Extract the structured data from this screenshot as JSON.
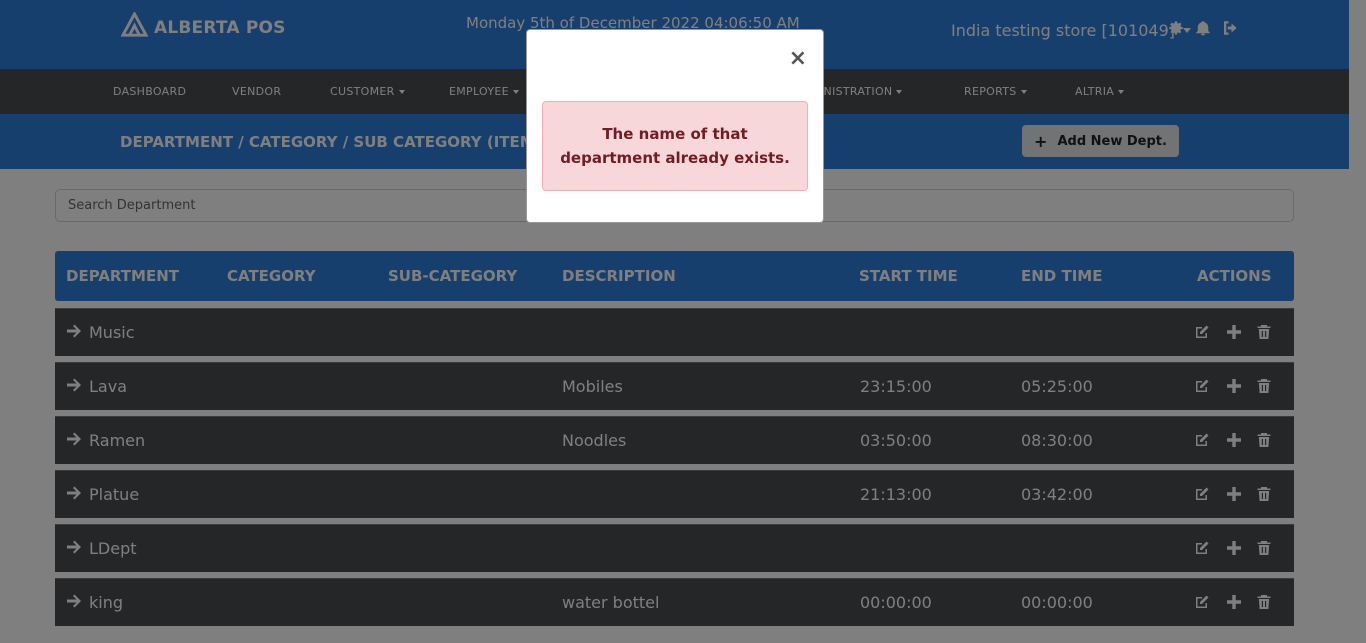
{
  "app": {
    "brand": "ALBERTA POS",
    "datetime": "Monday 5th of December 2022 04:06:50 AM",
    "store": "India testing store [101049]"
  },
  "nav": {
    "items": [
      {
        "label": "DASHBOARD"
      },
      {
        "label": "VENDOR"
      },
      {
        "label": "CUSTOMER"
      },
      {
        "label": "EMPLOYEE"
      },
      {
        "label": "INISTRATION"
      },
      {
        "label": "REPORTS"
      },
      {
        "label": "ALTRIA"
      }
    ]
  },
  "page": {
    "title": "DEPARTMENT / CATEGORY / SUB CATEGORY (ITEM CLASS",
    "add_label": "Add New Dept."
  },
  "search": {
    "placeholder": "Search Department"
  },
  "table": {
    "headers": [
      "DEPARTMENT",
      "CATEGORY",
      "SUB-CATEGORY",
      "DESCRIPTION",
      "START TIME",
      "END TIME",
      "ACTIONS"
    ],
    "rows": [
      {
        "department": "Music",
        "description": "",
        "start": "",
        "end": ""
      },
      {
        "department": "Lava",
        "description": "Mobiles",
        "start": "23:15:00",
        "end": "05:25:00"
      },
      {
        "department": "Ramen",
        "description": "Noodles",
        "start": "03:50:00",
        "end": "08:30:00"
      },
      {
        "department": "Platue",
        "description": "",
        "start": "21:13:00",
        "end": "03:42:00"
      },
      {
        "department": "LDept",
        "description": "",
        "start": "",
        "end": ""
      },
      {
        "department": "king",
        "description": "water bottel",
        "start": "00:00:00",
        "end": "00:00:00"
      }
    ]
  },
  "modal": {
    "close": "×",
    "message": "The name of that department already exists."
  },
  "colors": {
    "primary": "#2f7fdc",
    "dark_row": "#4a4c50",
    "alert_bg": "#f8d7da",
    "alert_text": "#721c24"
  }
}
